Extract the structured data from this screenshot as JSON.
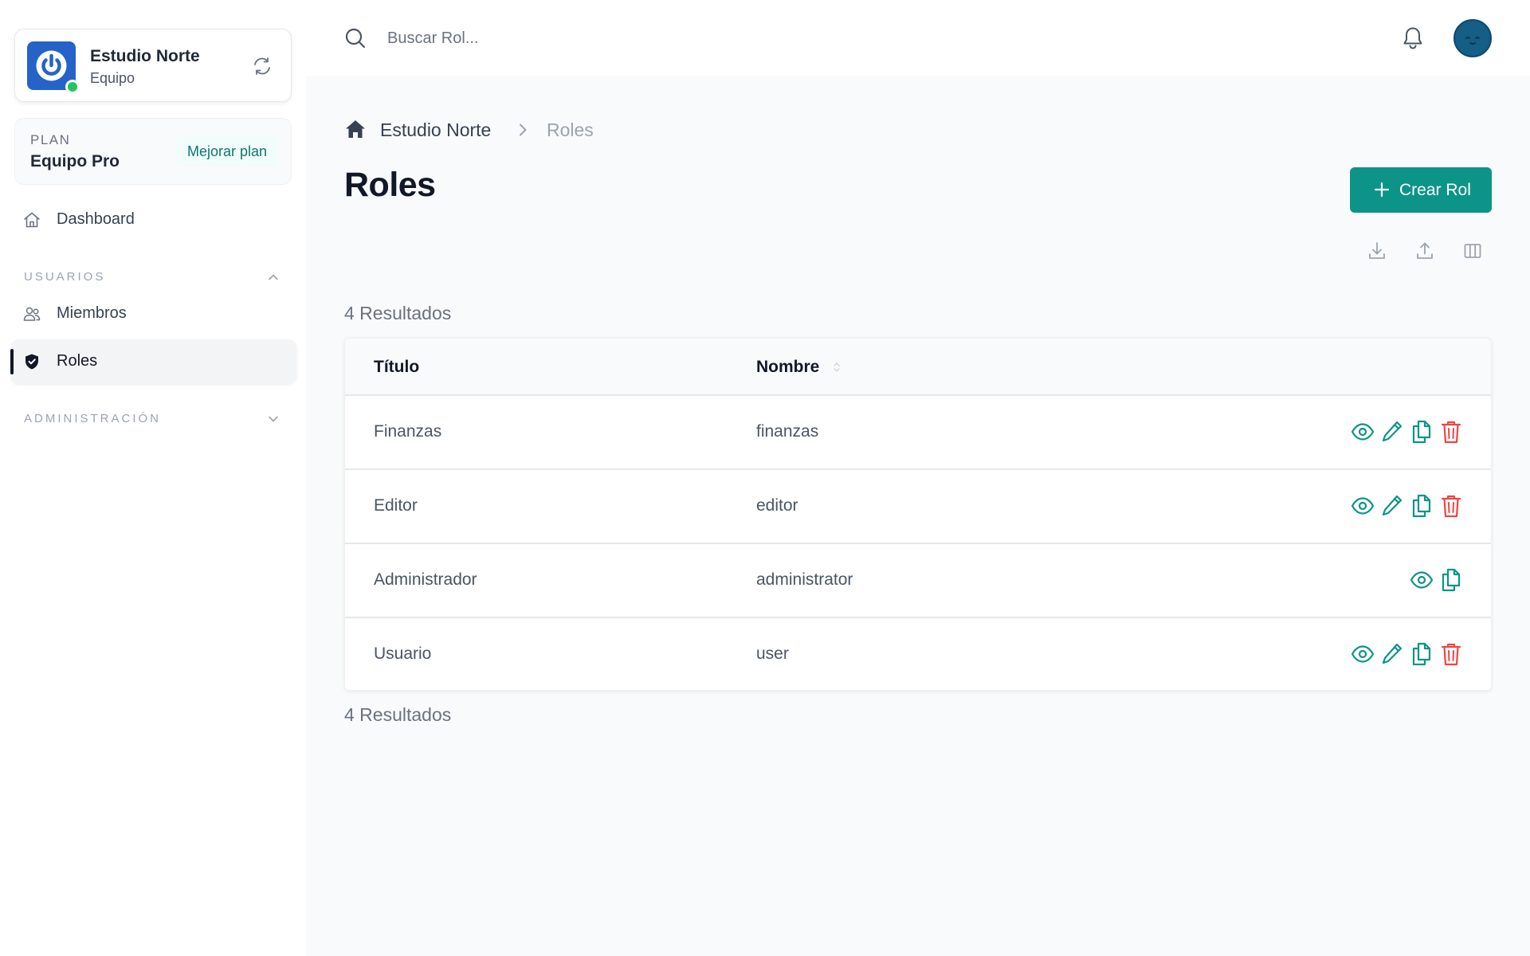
{
  "workspace": {
    "name": "Estudio Norte",
    "type": "Equipo"
  },
  "plan": {
    "label": "PLAN",
    "name": "Equipo Pro",
    "upgrade_label": "Mejorar plan"
  },
  "sidebar": {
    "dashboard_label": "Dashboard",
    "sections": [
      {
        "label": "USUARIOS",
        "expanded": true
      },
      {
        "label": "ADMINISTRACIÓN",
        "expanded": false
      }
    ],
    "items": [
      {
        "label": "Miembros",
        "icon": "users-icon"
      },
      {
        "label": "Roles",
        "icon": "shield-check-icon",
        "active": true
      }
    ]
  },
  "search": {
    "placeholder": "Buscar Rol..."
  },
  "breadcrumb": {
    "org": "Estudio Norte",
    "current": "Roles"
  },
  "page": {
    "title": "Roles",
    "create_label": "Crear Rol",
    "results_text": "4 Resultados"
  },
  "toolbar_icons": [
    "download-icon",
    "upload-icon",
    "columns-icon"
  ],
  "table": {
    "columns": [
      "Título",
      "Nombre"
    ],
    "rows": [
      {
        "title": "Finanzas",
        "name": "finanzas",
        "actions": [
          "view",
          "edit",
          "duplicate",
          "delete"
        ]
      },
      {
        "title": "Editor",
        "name": "editor",
        "actions": [
          "view",
          "edit",
          "duplicate",
          "delete"
        ]
      },
      {
        "title": "Administrador",
        "name": "administrator",
        "actions": [
          "view",
          "duplicate"
        ]
      },
      {
        "title": "Usuario",
        "name": "user",
        "actions": [
          "view",
          "edit",
          "duplicate",
          "delete"
        ]
      }
    ]
  },
  "colors": {
    "accent": "#0d9488",
    "danger": "#ef4444",
    "brand": "#2563c9",
    "online": "#22c55e"
  }
}
